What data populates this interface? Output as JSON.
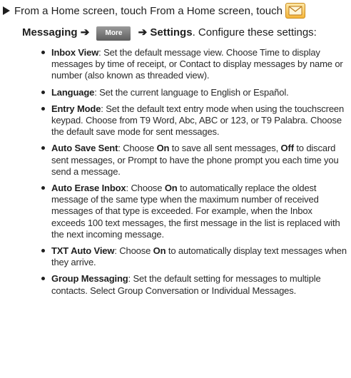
{
  "step": {
    "line1_text": "From a Home screen, touch From a Home screen, touch",
    "messaging_label": "Messaging",
    "arrow1": "➔",
    "more_label": "More",
    "arrow2": "➔",
    "settings_label": "Settings",
    "line2_rest": ". Configure these settings:"
  },
  "icons": {
    "step_marker": "right-triangle-icon",
    "messaging": "messaging-envelope-icon"
  },
  "colors": {
    "messaging_icon": "#f6b63a",
    "more_button": "#6e6e6e",
    "text": "#1f1f1f"
  },
  "settings": [
    {
      "term": "Inbox View",
      "parts": [
        ": Set the default message view. Choose Time to display messages by time of receipt, or Contact to display messages by name or number (also known as threaded view)."
      ]
    },
    {
      "term": "Language",
      "parts": [
        ": Set the current language to English or Español."
      ]
    },
    {
      "term": "Entry Mode",
      "parts": [
        ": Set the default text entry mode when using the touchscreen keypad. Choose from T9 Word, Abc, ABC or 123, or T9 Palabra. Choose the default save mode for sent messages."
      ]
    },
    {
      "term": "Auto Save Sent",
      "parts": [
        ": Choose ",
        "On",
        " to save all sent messages, ",
        "Off",
        " to discard sent messages, or Prompt to have the phone prompt you each time you send a message."
      ]
    },
    {
      "term": "Auto Erase Inbox",
      "parts": [
        ": Choose ",
        "On",
        " to automatically replace the oldest message of the same type when the maximum number of received messages of that type is exceeded. For example, when the Inbox exceeds 100 text messages, the first message in the list is replaced with the next incoming message."
      ]
    },
    {
      "term": "TXT Auto View",
      "parts": [
        ": Choose ",
        "On",
        " to automatically display text messages when they arrive."
      ]
    },
    {
      "term": "Group Messaging",
      "parts": [
        ": Set the default setting for messages to multiple contacts. Select Group Conversation or Individual Messages."
      ]
    }
  ]
}
